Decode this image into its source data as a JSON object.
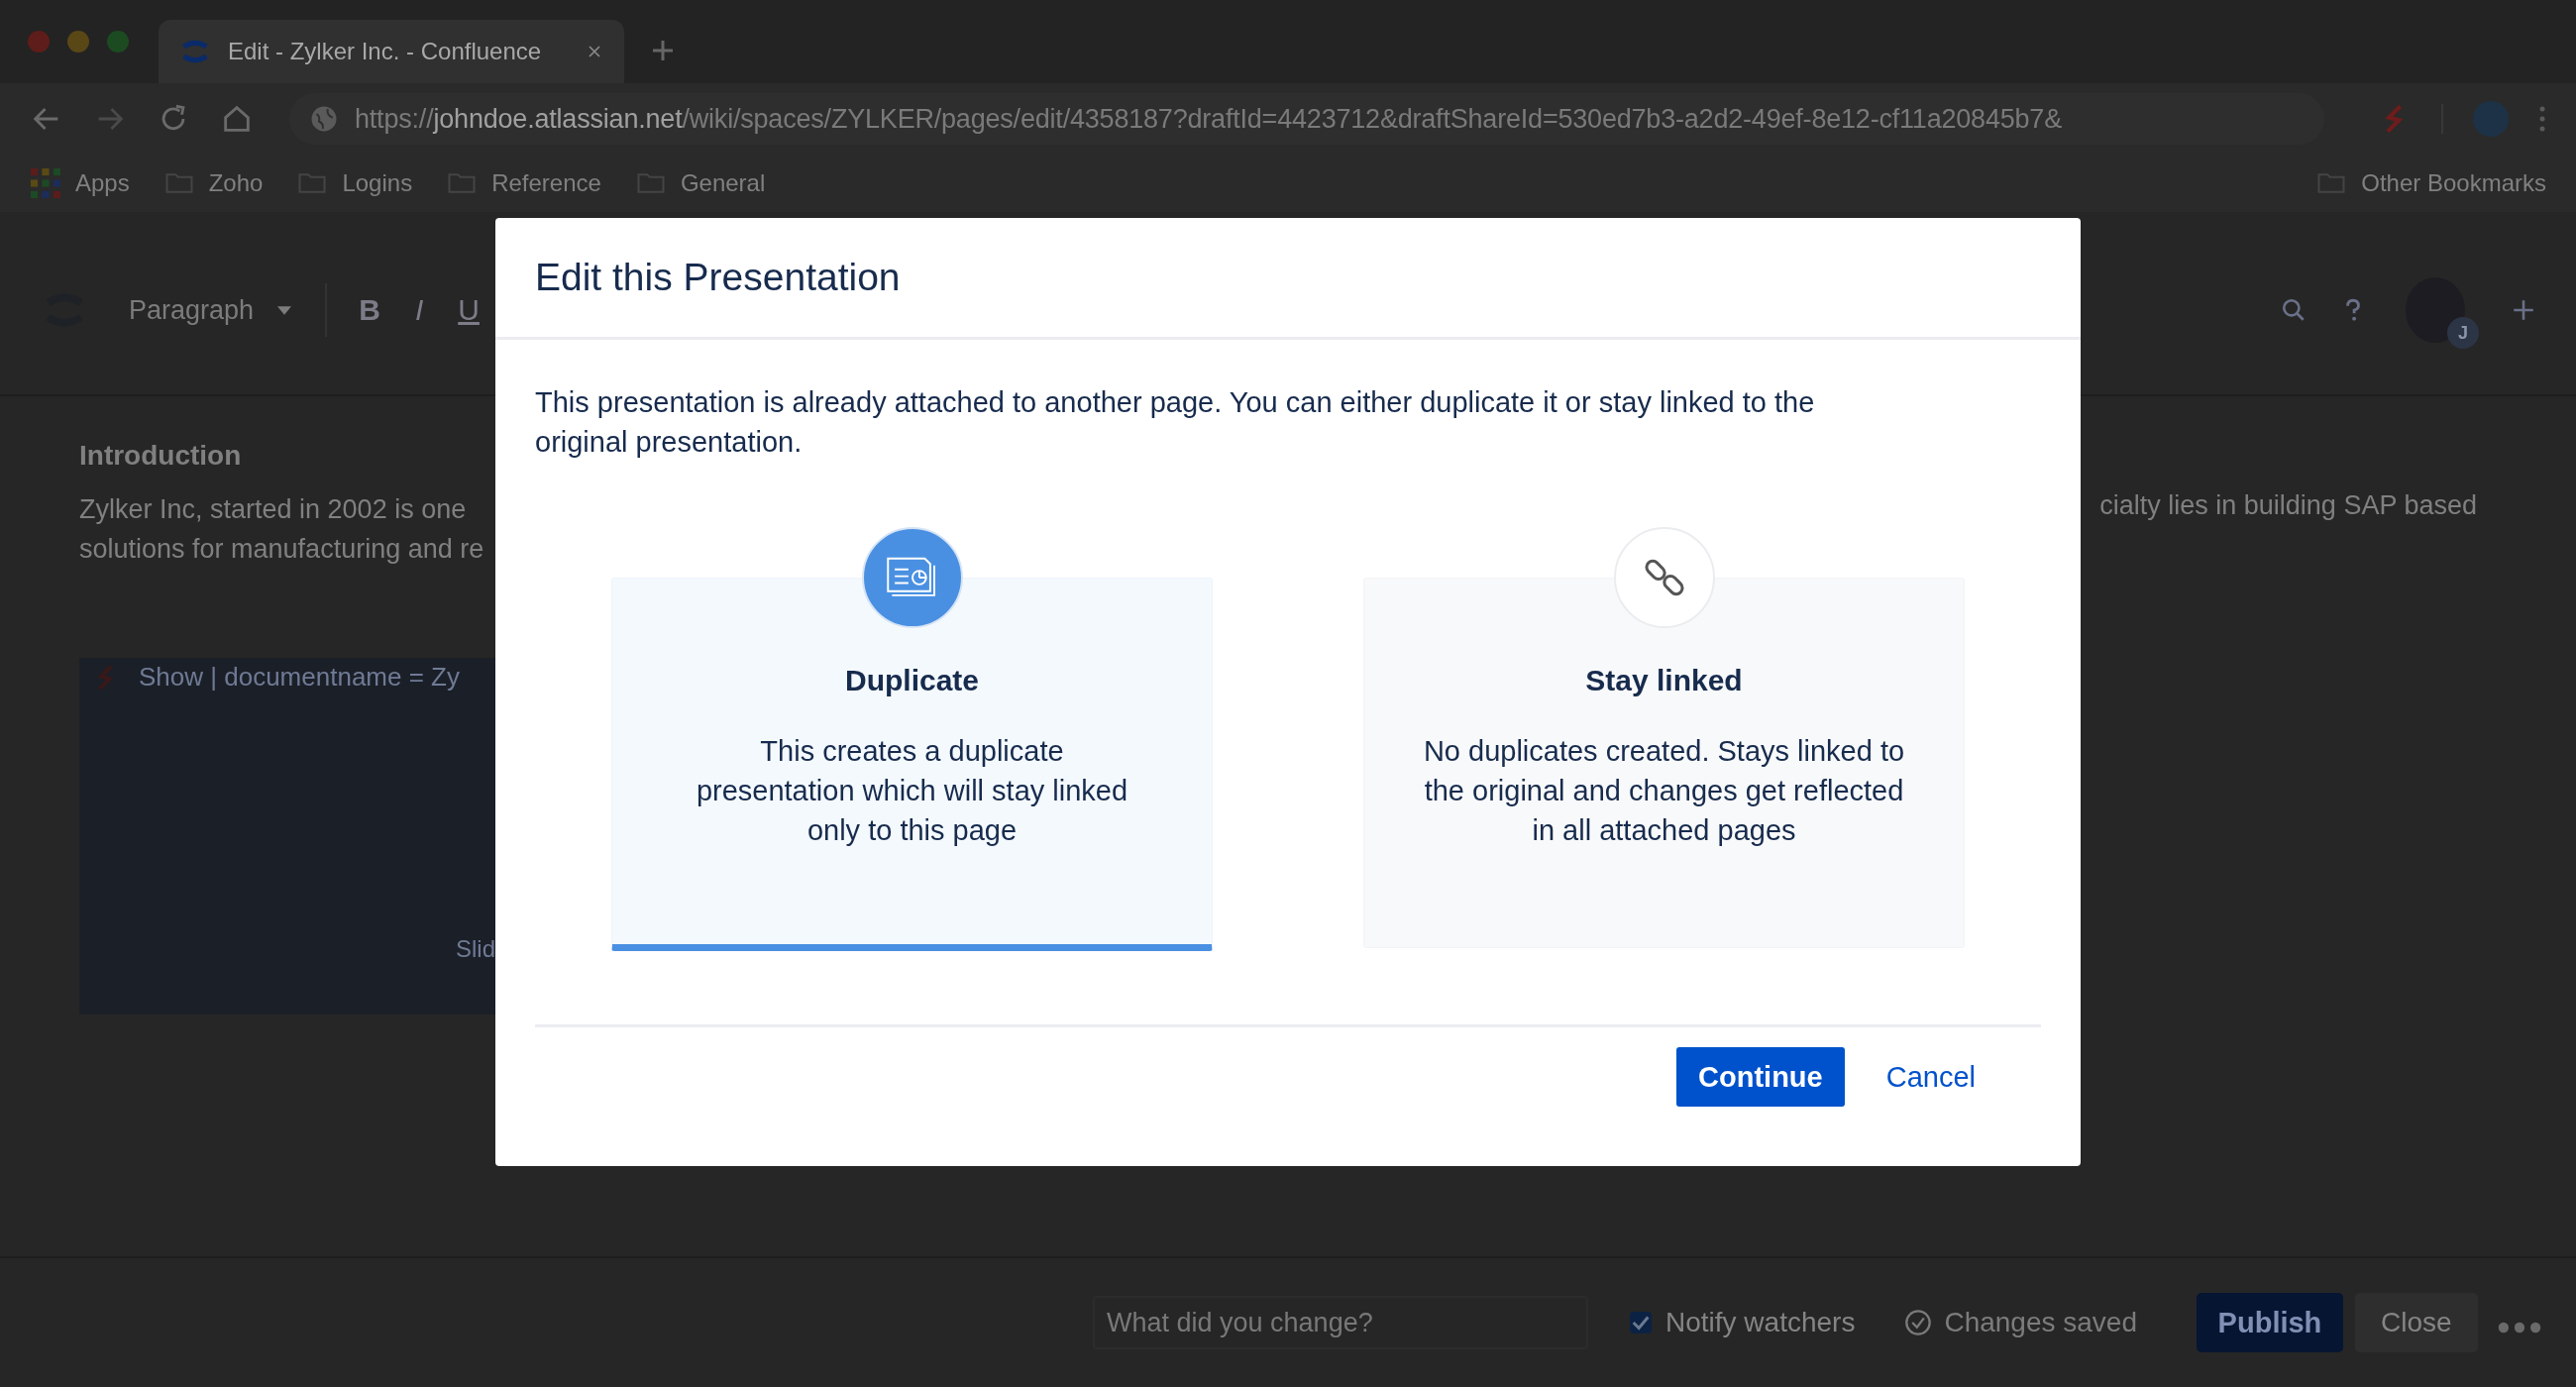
{
  "browser": {
    "tabs": [
      {
        "title": "Edit - Zylker Inc. - Confluence",
        "selected": true
      }
    ],
    "url": {
      "scheme": "https://",
      "host": "johndoe.atlassian.net",
      "path": "/wiki/spaces/ZYLKER/pages/edit/4358187?draftId=4423712&draftShareId=530ed7b3-a2d2-49ef-8e12-cf11a20845b7&"
    },
    "bookmarks": [
      {
        "label": "Apps",
        "kind": "apps"
      },
      {
        "label": "Zoho",
        "kind": "folder"
      },
      {
        "label": "Logins",
        "kind": "folder"
      },
      {
        "label": "Reference",
        "kind": "folder"
      },
      {
        "label": "General",
        "kind": "folder"
      }
    ],
    "other_bookmarks": "Other Bookmarks"
  },
  "editor": {
    "style_menu": "Paragraph",
    "format_buttons": [
      {
        "label": "B",
        "kind": "bold"
      },
      {
        "label": "I",
        "kind": "italic"
      },
      {
        "label": "U",
        "kind": "underline"
      }
    ],
    "avatar_badge": "J",
    "heading": "Introduction",
    "paragraph_left": [
      "Zylker Inc, started in 2002 is one",
      "solutions for manufacturing and re"
    ],
    "paragraph_right": [
      "cialty lies in building SAP based"
    ],
    "macro": {
      "title": "Show | documentname = Zy",
      "caption": "Slid"
    }
  },
  "bottom_bar": {
    "comment_placeholder": "What did you change?",
    "notify_watchers": {
      "label": "Notify watchers",
      "checked": true
    },
    "status": "Changes saved",
    "publish": "Publish",
    "close": "Close"
  },
  "dialog": {
    "title": "Edit this Presentation",
    "message": "This presentation is already attached to another page. You can either duplicate it or stay linked to the original presentation.",
    "options": [
      {
        "kind": "duplicate",
        "title": "Duplicate",
        "description": "This creates a duplicate presentation which will stay linked only to this page",
        "selected": true
      },
      {
        "kind": "link",
        "title": "Stay linked",
        "description": "No duplicates created. Stays linked to the original and changes get reflected in all attached pages",
        "selected": false
      }
    ],
    "buttons": [
      {
        "label": "Continue",
        "kind": "primary"
      },
      {
        "label": "Cancel",
        "kind": "link"
      }
    ]
  }
}
